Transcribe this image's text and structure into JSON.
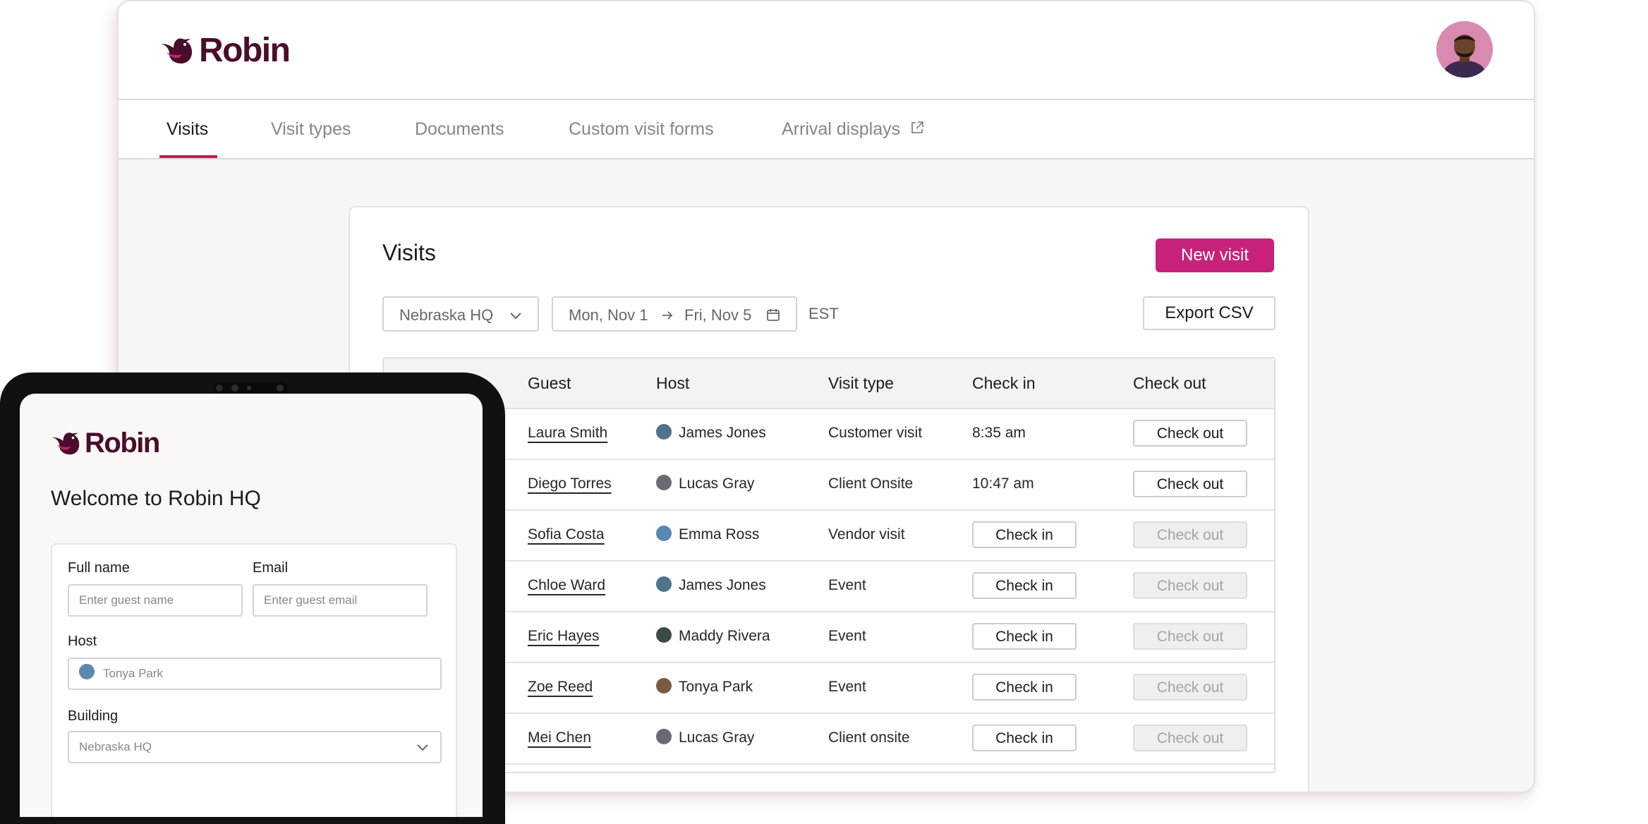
{
  "brand": {
    "name": "Robin",
    "color": "#4a0d2b",
    "accent": "#c8217a"
  },
  "tabs": [
    {
      "label": "Visits"
    },
    {
      "label": "Visit types"
    },
    {
      "label": "Documents"
    },
    {
      "label": "Custom visit forms"
    },
    {
      "label": "Arrival displays"
    }
  ],
  "visits": {
    "title": "Visits",
    "new_button": "New visit",
    "location": "Nebraska HQ",
    "date_start": "Mon, Nov 1",
    "date_end": "Fri, Nov 5",
    "timezone": "EST",
    "export_button": "Export CSV",
    "columns": {
      "guest": "Guest",
      "host": "Host",
      "visit_type": "Visit type",
      "check_in": "Check in",
      "check_out": "Check out"
    },
    "rows": [
      {
        "guest": "Laura Smith",
        "host": "James Jones",
        "type": "Customer visit",
        "check_in": "8:35 am",
        "check_out": "Check out"
      },
      {
        "guest": "Diego Torres",
        "host": "Lucas Gray",
        "type": "Client Onsite",
        "check_in": "10:47 am",
        "check_out": "Check out"
      },
      {
        "guest": "Sofia Costa",
        "host": "Emma Ross",
        "type": "Vendor visit",
        "check_in": "Check in",
        "check_out": "Check out"
      },
      {
        "guest": "Chloe Ward",
        "host": "James Jones",
        "type": "Event",
        "check_in": "Check in",
        "check_out": "Check out"
      },
      {
        "guest": "Eric Hayes",
        "host": "Maddy Rivera",
        "type": "Event",
        "check_in": "Check in",
        "check_out": "Check out"
      },
      {
        "guest": "Zoe Reed",
        "host": "Tonya Park",
        "type": "Event",
        "check_in": "Check in",
        "check_out": "Check out"
      },
      {
        "guest": "Mei Chen",
        "host": "Lucas Gray",
        "type": "Client onsite",
        "check_in": "Check in",
        "check_out": "Check out"
      }
    ]
  },
  "tablet": {
    "brand": "Robin",
    "welcome": "Welcome to Robin HQ",
    "full_name_label": "Full name",
    "full_name_placeholder": "Enter guest name",
    "email_label": "Email",
    "email_placeholder": "Enter guest email",
    "host_label": "Host",
    "host_value": "Tonya Park",
    "building_label": "Building",
    "building_value": "Nebraska HQ"
  }
}
